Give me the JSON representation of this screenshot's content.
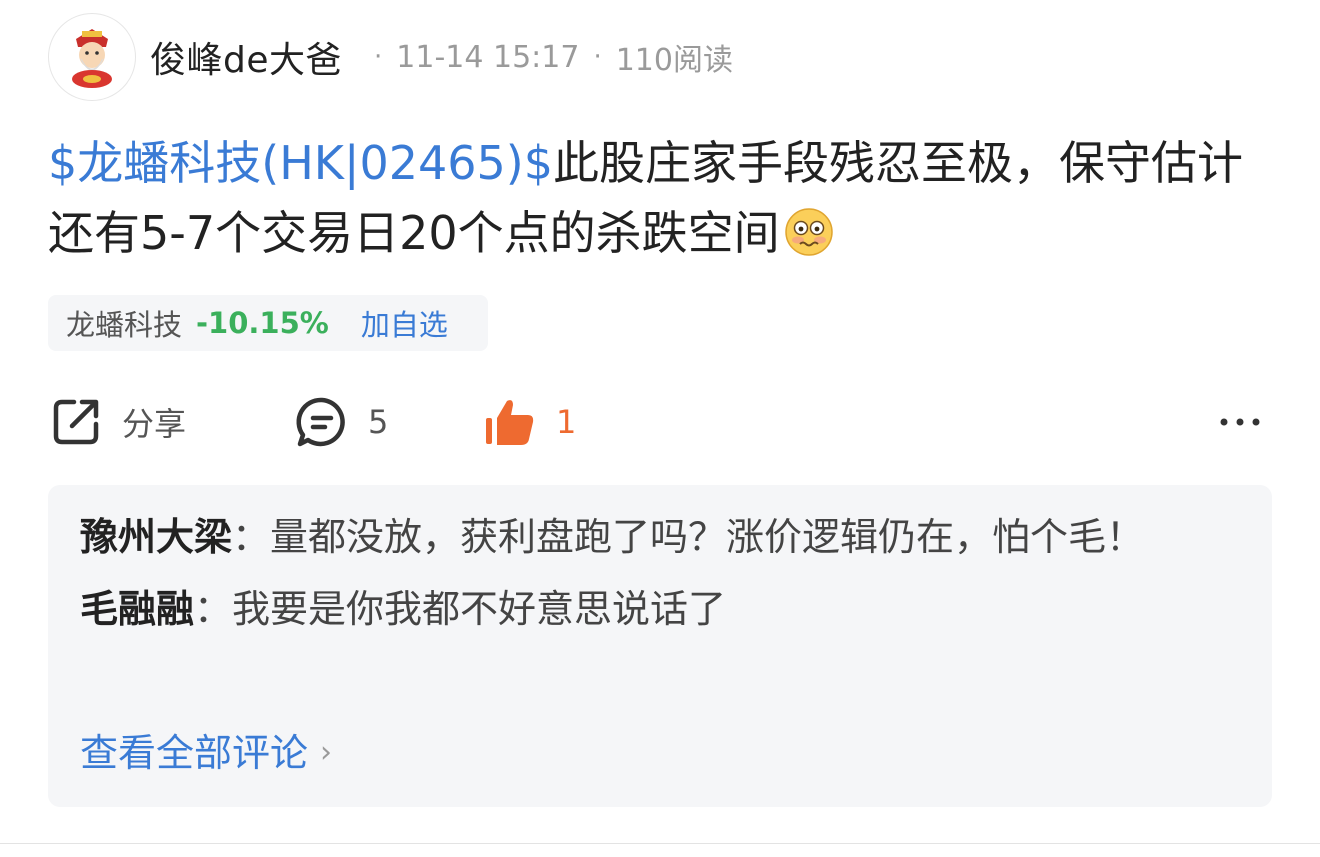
{
  "post": {
    "author": "俊峰de大爸",
    "time": "11-14 15:17",
    "reads": "110阅读",
    "stock_tag": "$龙蟠科技(HK|02465)$",
    "text": "此股庄家手段残忍至极，保守估计还有5-7个交易日20个点的杀跌空间",
    "emoji_icon": "anxious-face-icon"
  },
  "stock_chip": {
    "name": "龙蟠科技",
    "change": "-10.15%",
    "add_label": "加自选",
    "change_color": "#3bb05c"
  },
  "actions": {
    "share_label": "分享",
    "comment_count": "5",
    "like_count": "1",
    "like_color": "#ee6a30"
  },
  "comments": [
    {
      "user": "豫州大梁",
      "sep": "：",
      "text": "量都没放，获利盘跑了吗？涨价逻辑仍在，怕个毛！"
    },
    {
      "user": "毛融融",
      "sep": "：",
      "text": "我要是你我都不好意思说话了"
    }
  ],
  "view_all_label": "查看全部评论"
}
